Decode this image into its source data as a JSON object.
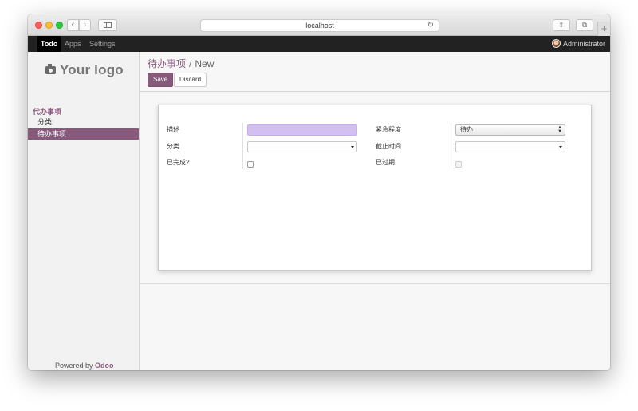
{
  "browser": {
    "url": "localhost"
  },
  "topnav": {
    "items": [
      "Todo",
      "Apps",
      "Settings"
    ],
    "user": "Administrator"
  },
  "sidebar": {
    "logo_text": "Your logo",
    "group_label": "代办事项",
    "items": [
      "分类",
      "待办事项"
    ],
    "powered_prefix": "Powered by",
    "powered_brand": "Odoo"
  },
  "control_panel": {
    "breadcrumb_parent": "待办事项",
    "breadcrumb_current": "New",
    "save_label": "Save",
    "discard_label": "Discard"
  },
  "form": {
    "description_label": "描述",
    "description_value": "",
    "category_label": "分类",
    "category_value": "",
    "done_label": "已完成?",
    "urgency_label": "紧急程度",
    "urgency_value": "待办",
    "deadline_label": "截止时间",
    "deadline_value": "",
    "expired_label": "已过期"
  },
  "colors": {
    "brand": "#875a7b",
    "required_field": "#d2c0f2",
    "topbar": "#222222"
  }
}
